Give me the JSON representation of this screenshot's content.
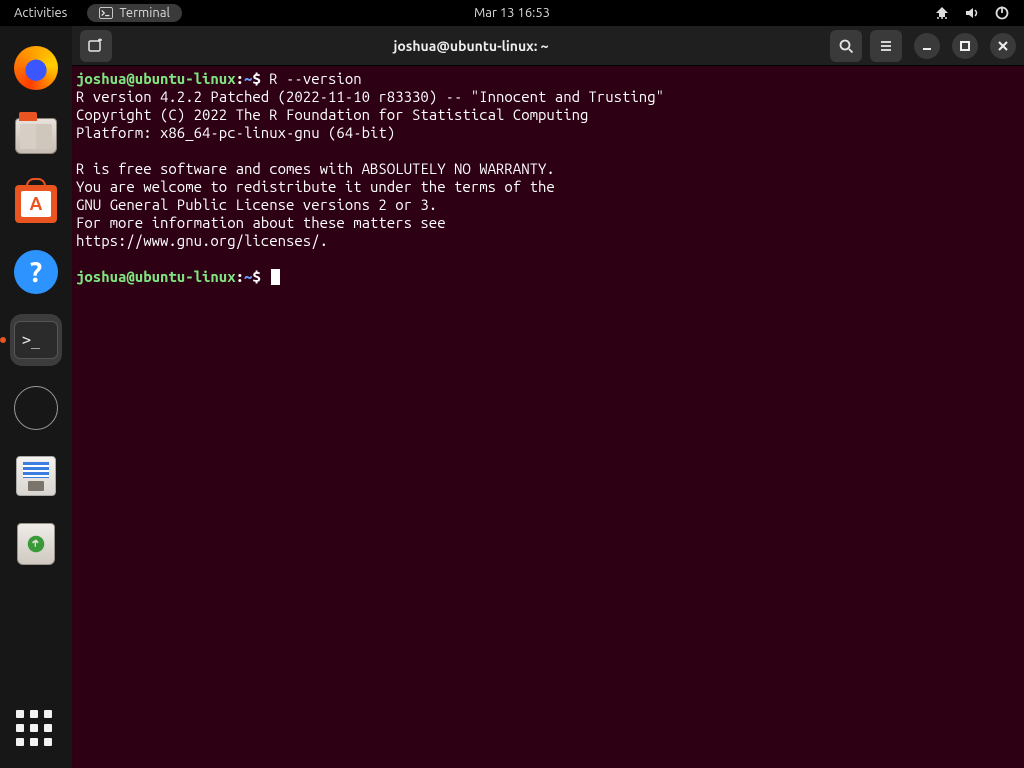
{
  "topbar": {
    "activities": "Activities",
    "app_label": "Terminal",
    "clock": "Mar 13  16:53"
  },
  "dock": {
    "items": [
      {
        "name": "firefox"
      },
      {
        "name": "files"
      },
      {
        "name": "software"
      },
      {
        "name": "help"
      },
      {
        "name": "terminal",
        "active": true
      },
      {
        "name": "disk"
      },
      {
        "name": "screenshot"
      },
      {
        "name": "trash"
      }
    ]
  },
  "window": {
    "title": "joshua@ubuntu-linux: ~"
  },
  "terminal": {
    "prompt_user": "joshua@ubuntu-linux",
    "prompt_sep1": ":",
    "prompt_path": "~",
    "prompt_sep2": "$ ",
    "command1": "R --version",
    "output": "R version 4.2.2 Patched (2022-11-10 r83330) -- \"Innocent and Trusting\"\nCopyright (C) 2022 The R Foundation for Statistical Computing\nPlatform: x86_64-pc-linux-gnu (64-bit)\n\nR is free software and comes with ABSOLUTELY NO WARRANTY.\nYou are welcome to redistribute it under the terms of the\nGNU General Public License versions 2 or 3.\nFor more information about these matters see\nhttps://www.gnu.org/licenses/.\n"
  }
}
